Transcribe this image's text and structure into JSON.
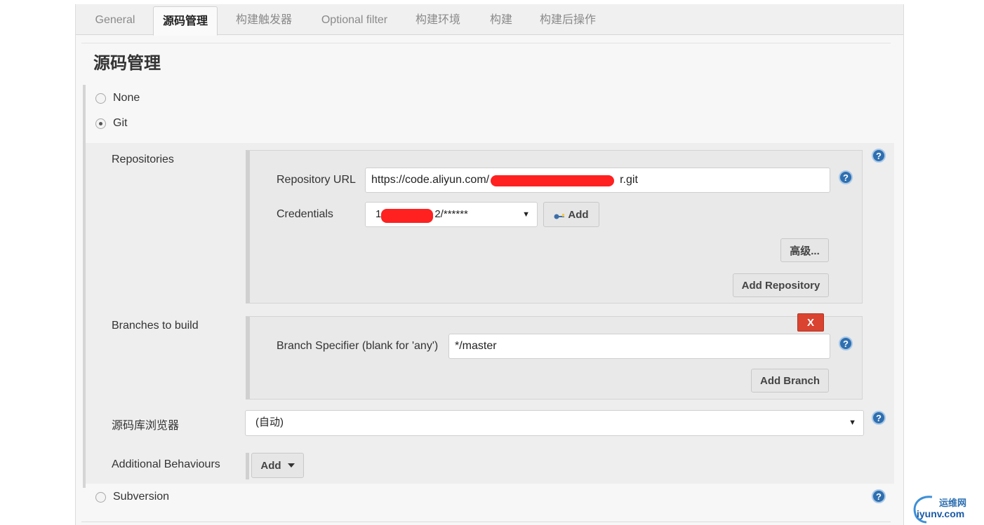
{
  "tabs": [
    {
      "label": "General",
      "active": false
    },
    {
      "label": "源码管理",
      "active": true
    },
    {
      "label": "构建触发器",
      "active": false
    },
    {
      "label": "Optional filter",
      "active": false
    },
    {
      "label": "构建环境",
      "active": false
    },
    {
      "label": "构建",
      "active": false
    },
    {
      "label": "构建后操作",
      "active": false
    }
  ],
  "section_title": "源码管理",
  "scm_options": {
    "none": {
      "label": "None",
      "checked": false
    },
    "git": {
      "label": "Git",
      "checked": true
    },
    "subversion": {
      "label": "Subversion",
      "checked": false
    }
  },
  "git": {
    "repositories_label": "Repositories",
    "repository_url_label": "Repository URL",
    "repository_url_prefix": "https://code.aliyun.com/",
    "repository_url_suffix": "r.git",
    "credentials_label": "Credentials",
    "credentials_prefix": "1",
    "credentials_suffix": "2/******",
    "add_credentials_label": "Add",
    "advanced_label": "高级...",
    "add_repository_label": "Add Repository",
    "branches_label": "Branches to build",
    "delete_branch_label": "X",
    "branch_specifier_label": "Branch Specifier (blank for 'any')",
    "branch_specifier_value": "*/master",
    "add_branch_label": "Add Branch",
    "browser_label": "源码库浏览器",
    "browser_value": "(自动)",
    "additional_behaviours_label": "Additional Behaviours",
    "add_behaviour_label": "Add"
  },
  "help_glyph": "?",
  "caret_glyph": "▼",
  "watermark": {
    "line1": "运维网",
    "line2": "iyunv.com"
  },
  "colors": {
    "help": "#2f6fb0",
    "delete": "#d9432f",
    "redaction": "#ff2020"
  }
}
